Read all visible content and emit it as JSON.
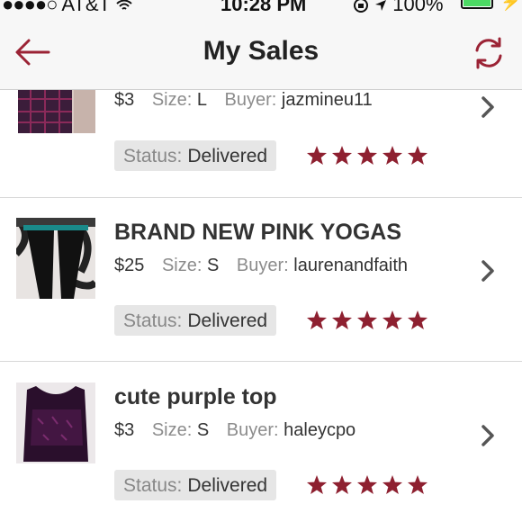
{
  "status_bar": {
    "dots": "●●●●○",
    "carrier": "AT&T",
    "time": "10:28 PM",
    "battery": "100%"
  },
  "nav": {
    "title": "My Sales"
  },
  "colors": {
    "accent": "#9b2335",
    "star": "#8e2030",
    "status_bg": "#e6e6e6"
  },
  "labels": {
    "size": "Size:",
    "buyer": "Buyer:",
    "status": "Status:"
  },
  "sales": [
    {
      "title": "",
      "price": "$3",
      "size": "L",
      "buyer": "jazmineu11",
      "status": "Delivered",
      "rating": 5
    },
    {
      "title": "BRAND NEW PINK YOGAS",
      "price": "$25",
      "size": "S",
      "buyer": "laurenandfaith",
      "status": "Delivered",
      "rating": 5
    },
    {
      "title": "cute purple top",
      "price": "$3",
      "size": "S",
      "buyer": "haleycpo",
      "status": "Delivered",
      "rating": 5
    }
  ]
}
